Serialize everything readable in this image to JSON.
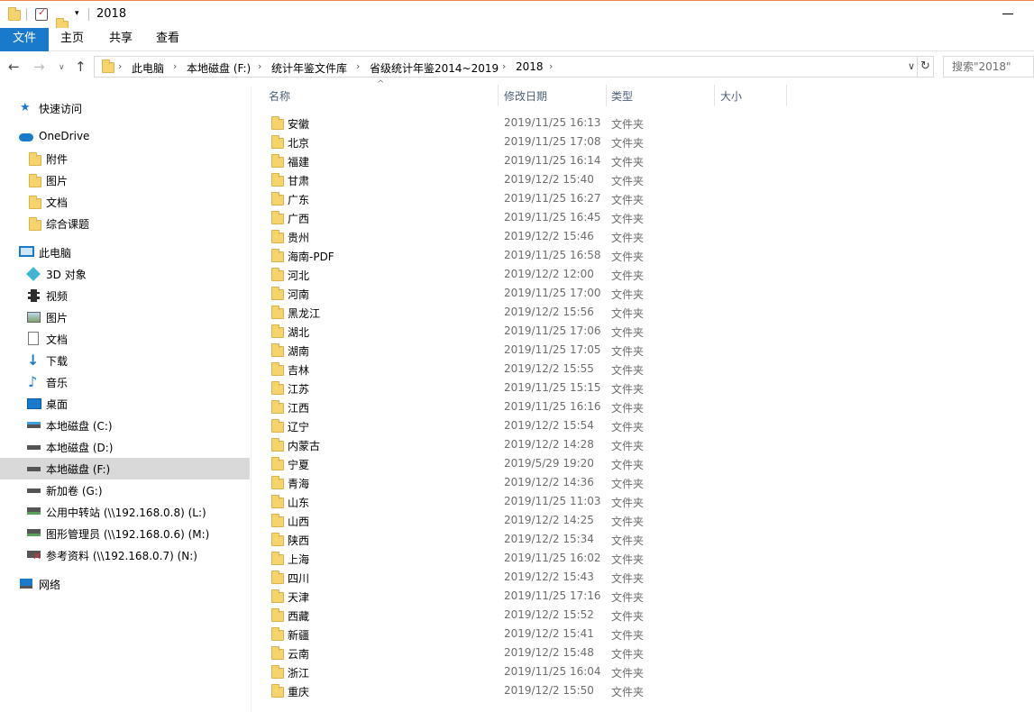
{
  "window": {
    "title": "2018"
  },
  "ribbon": {
    "tabs": [
      {
        "label": "文件"
      },
      {
        "label": "主页"
      },
      {
        "label": "共享"
      },
      {
        "label": "查看"
      }
    ]
  },
  "address": {
    "crumbs": [
      "此电脑",
      "本地磁盘 (F:)",
      "统计年鉴文件库",
      "省级统计年鉴2014~2019",
      "2018"
    ]
  },
  "search": {
    "placeholder": "搜索\"2018\""
  },
  "sidebar": {
    "quick_access": "快速访问",
    "onedrive": "OneDrive",
    "onedrive_items": [
      "附件",
      "图片",
      "文档",
      "综合课题"
    ],
    "this_pc": "此电脑",
    "pc_items": [
      "3D 对象",
      "视频",
      "图片",
      "文档",
      "下载",
      "音乐",
      "桌面"
    ],
    "drives": [
      "本地磁盘 (C:)",
      "本地磁盘 (D:)",
      "本地磁盘 (F:)",
      "新加卷 (G:)",
      "公用中转站 (\\\\192.168.0.8) (L:)",
      "图形管理员 (\\\\192.168.0.6) (M:)",
      "参考资料 (\\\\192.168.0.7) (N:)"
    ],
    "selected_drive": "本地磁盘 (F:)",
    "network": "网络"
  },
  "columns": {
    "name": "名称",
    "modified": "修改日期",
    "type": "类型",
    "size": "大小"
  },
  "files": [
    {
      "name": "安徽",
      "modified": "2019/11/25 16:13",
      "type": "文件夹"
    },
    {
      "name": "北京",
      "modified": "2019/11/25 17:08",
      "type": "文件夹"
    },
    {
      "name": "福建",
      "modified": "2019/11/25 16:14",
      "type": "文件夹"
    },
    {
      "name": "甘肃",
      "modified": "2019/12/2 15:40",
      "type": "文件夹"
    },
    {
      "name": "广东",
      "modified": "2019/11/25 16:27",
      "type": "文件夹"
    },
    {
      "name": "广西",
      "modified": "2019/11/25 16:45",
      "type": "文件夹"
    },
    {
      "name": "贵州",
      "modified": "2019/12/2 15:46",
      "type": "文件夹"
    },
    {
      "name": "海南-PDF",
      "modified": "2019/11/25 16:58",
      "type": "文件夹"
    },
    {
      "name": "河北",
      "modified": "2019/12/2 12:00",
      "type": "文件夹"
    },
    {
      "name": "河南",
      "modified": "2019/11/25 17:00",
      "type": "文件夹"
    },
    {
      "name": "黑龙江",
      "modified": "2019/12/2 15:56",
      "type": "文件夹"
    },
    {
      "name": "湖北",
      "modified": "2019/11/25 17:06",
      "type": "文件夹"
    },
    {
      "name": "湖南",
      "modified": "2019/11/25 17:05",
      "type": "文件夹"
    },
    {
      "name": "吉林",
      "modified": "2019/12/2 15:55",
      "type": "文件夹"
    },
    {
      "name": "江苏",
      "modified": "2019/11/25 15:15",
      "type": "文件夹"
    },
    {
      "name": "江西",
      "modified": "2019/11/25 16:16",
      "type": "文件夹"
    },
    {
      "name": "辽宁",
      "modified": "2019/12/2 15:54",
      "type": "文件夹"
    },
    {
      "name": "内蒙古",
      "modified": "2019/12/2 14:28",
      "type": "文件夹"
    },
    {
      "name": "宁夏",
      "modified": "2019/5/29 19:20",
      "type": "文件夹"
    },
    {
      "name": "青海",
      "modified": "2019/12/2 14:36",
      "type": "文件夹"
    },
    {
      "name": "山东",
      "modified": "2019/11/25 11:03",
      "type": "文件夹"
    },
    {
      "name": "山西",
      "modified": "2019/12/2 14:25",
      "type": "文件夹"
    },
    {
      "name": "陕西",
      "modified": "2019/12/2 15:34",
      "type": "文件夹"
    },
    {
      "name": "上海",
      "modified": "2019/11/25 16:02",
      "type": "文件夹"
    },
    {
      "name": "四川",
      "modified": "2019/12/2 15:43",
      "type": "文件夹"
    },
    {
      "name": "天津",
      "modified": "2019/11/25 17:16",
      "type": "文件夹"
    },
    {
      "name": "西藏",
      "modified": "2019/12/2 15:52",
      "type": "文件夹"
    },
    {
      "name": "新疆",
      "modified": "2019/12/2 15:41",
      "type": "文件夹"
    },
    {
      "name": "云南",
      "modified": "2019/12/2 15:48",
      "type": "文件夹"
    },
    {
      "name": "浙江",
      "modified": "2019/11/25 16:04",
      "type": "文件夹"
    },
    {
      "name": "重庆",
      "modified": "2019/12/2 15:50",
      "type": "文件夹"
    }
  ]
}
